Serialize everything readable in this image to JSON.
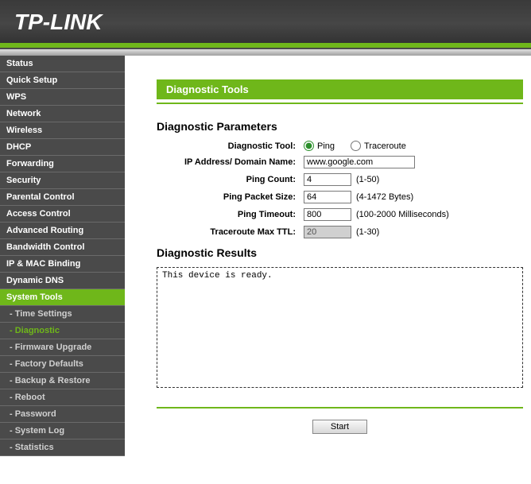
{
  "logo": "TP-LINK",
  "sidebar": {
    "items": [
      {
        "label": "Status",
        "type": "main"
      },
      {
        "label": "Quick Setup",
        "type": "main"
      },
      {
        "label": "WPS",
        "type": "main"
      },
      {
        "label": "Network",
        "type": "main"
      },
      {
        "label": "Wireless",
        "type": "main"
      },
      {
        "label": "DHCP",
        "type": "main"
      },
      {
        "label": "Forwarding",
        "type": "main"
      },
      {
        "label": "Security",
        "type": "main"
      },
      {
        "label": "Parental Control",
        "type": "main"
      },
      {
        "label": "Access Control",
        "type": "main"
      },
      {
        "label": "Advanced Routing",
        "type": "main"
      },
      {
        "label": "Bandwidth Control",
        "type": "main"
      },
      {
        "label": "IP & MAC Binding",
        "type": "main"
      },
      {
        "label": "Dynamic DNS",
        "type": "main"
      },
      {
        "label": "System Tools",
        "type": "main",
        "active": true
      },
      {
        "label": "- Time Settings",
        "type": "sub"
      },
      {
        "label": "- Diagnostic",
        "type": "sub",
        "active": true
      },
      {
        "label": "- Firmware Upgrade",
        "type": "sub"
      },
      {
        "label": "- Factory Defaults",
        "type": "sub"
      },
      {
        "label": "- Backup & Restore",
        "type": "sub"
      },
      {
        "label": "- Reboot",
        "type": "sub"
      },
      {
        "label": "- Password",
        "type": "sub"
      },
      {
        "label": "- System Log",
        "type": "sub"
      },
      {
        "label": "- Statistics",
        "type": "sub"
      }
    ]
  },
  "page": {
    "title": "Diagnostic Tools",
    "parameters_title": "Diagnostic Parameters",
    "results_title": "Diagnostic Results",
    "labels": {
      "tool": "Diagnostic Tool:",
      "ip": "IP Address/ Domain Name:",
      "count": "Ping Count:",
      "packet_size": "Ping Packet Size:",
      "timeout": "Ping Timeout:",
      "max_ttl": "Traceroute Max TTL:"
    },
    "tool_options": {
      "ping": "Ping",
      "traceroute": "Traceroute"
    },
    "tool_selected": "ping",
    "values": {
      "ip": "www.google.com",
      "count": "4",
      "packet_size": "64",
      "timeout": "800",
      "max_ttl": "20"
    },
    "hints": {
      "count": "(1-50)",
      "packet_size": "(4-1472 Bytes)",
      "timeout": "(100-2000 Milliseconds)",
      "max_ttl": "(1-30)"
    },
    "results_text": "This device is ready.",
    "start_button": "Start"
  }
}
